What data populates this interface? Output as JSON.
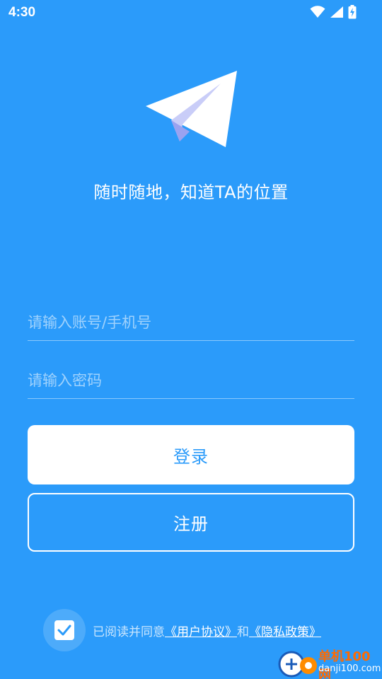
{
  "status_bar": {
    "time": "4:30",
    "icons": [
      "wifi-icon",
      "signal-icon",
      "battery-charging-icon"
    ]
  },
  "brand": {
    "logo_icon": "paper-plane-icon",
    "slogan": "随时随地，知道TA的位置"
  },
  "form": {
    "account_placeholder": "请输入账号/手机号",
    "password_placeholder": "请输入密码",
    "login_label": "登录",
    "register_label": "注册"
  },
  "agreement": {
    "checked": true,
    "prefix": "已阅读并同意",
    "user_agreement": "《用户协议》",
    "and": "和",
    "privacy_policy": "《隐私政策》"
  },
  "watermark": {
    "title": "单机100网",
    "domain": "danji100.com"
  },
  "colors": {
    "background": "#2b9bfa",
    "primary_text": "#ffffff",
    "button_text": "#2b9bfa"
  }
}
